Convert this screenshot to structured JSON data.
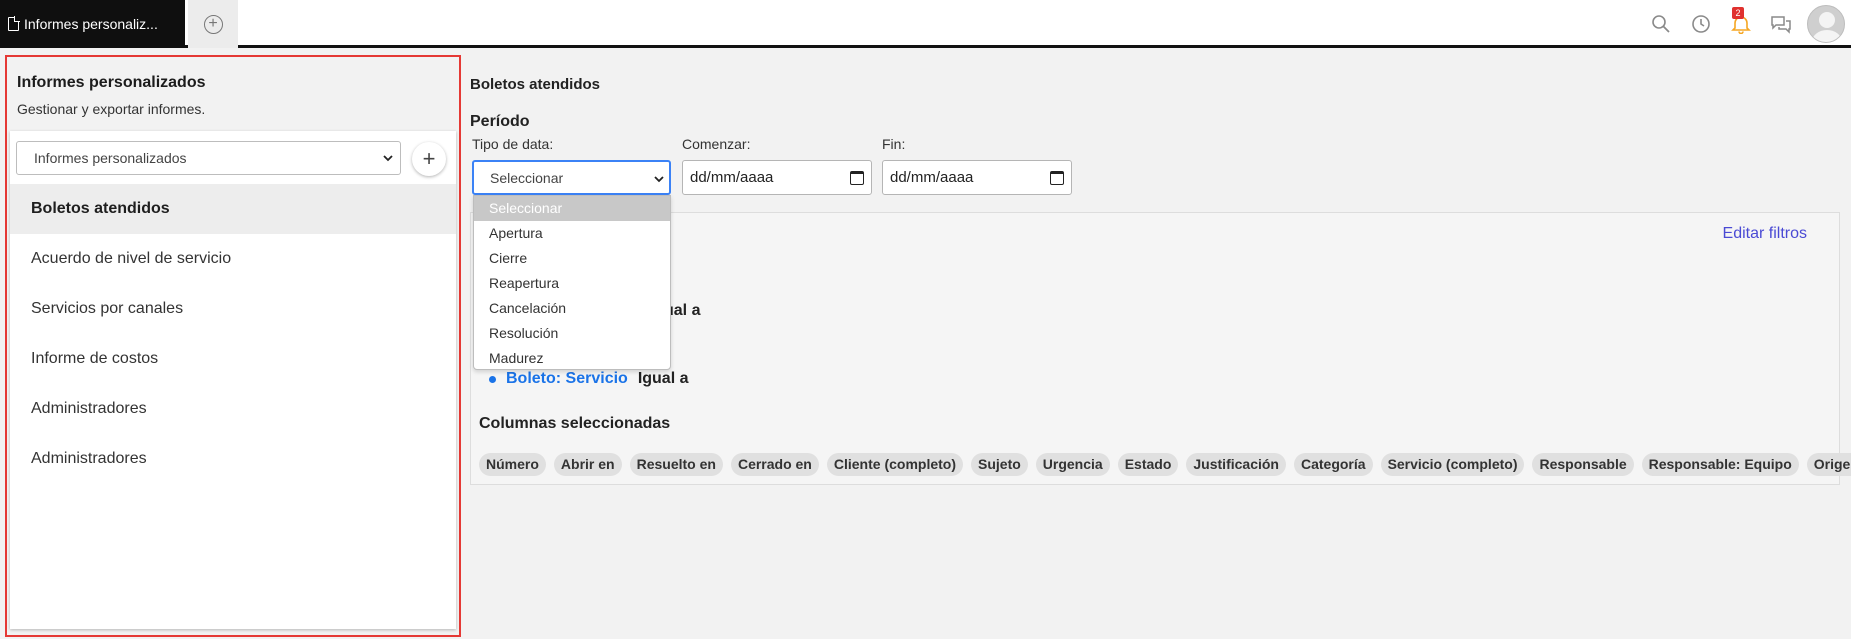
{
  "topbar": {
    "tab_label": "Informes personaliz...",
    "notification_count": "2"
  },
  "sidebar": {
    "title": "Informes personalizados",
    "subtitle": "Gestionar y exportar informes.",
    "select_value": "Informes personalizados",
    "items": [
      {
        "label": "Boletos atendidos"
      },
      {
        "label": "Acuerdo de nivel de servicio"
      },
      {
        "label": "Servicios por canales"
      },
      {
        "label": "Informe de costos"
      },
      {
        "label": "Administradores"
      },
      {
        "label": "Administradores"
      }
    ]
  },
  "main": {
    "title": "Boletos atendidos",
    "period_label": "Período",
    "date_type_label": "Tipo de data:",
    "date_type_value": "Seleccionar",
    "start_label": "Comenzar:",
    "start_value": "dd/mm/aaaa",
    "end_label": "Fin:",
    "end_value": "dd/mm/aaaa",
    "edit_filters": "Editar filtros",
    "condition1_tail": "ual a",
    "condition2_field": "Boleto: Servicio",
    "condition2_op": "Igual a",
    "columns_title": "Columnas seleccionadas",
    "columns": [
      "Número",
      "Abrir en",
      "Resuelto en",
      "Cerrado en",
      "Cliente (completo)",
      "Sujeto",
      "Urgencia",
      "Estado",
      "Justificación",
      "Categoría",
      "Servicio (completo)",
      "Responsable",
      "Responsable: Equipo",
      "Origen"
    ]
  },
  "dropdown": {
    "options": [
      "Seleccionar",
      "Apertura",
      "Cierre",
      "Reapertura",
      "Cancelación",
      "Resolución",
      "Madurez"
    ]
  }
}
